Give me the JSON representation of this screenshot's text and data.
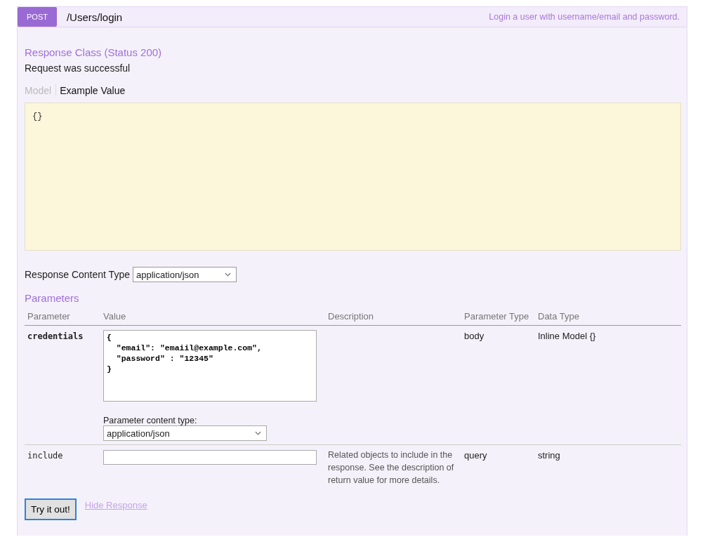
{
  "operation": {
    "method": "POST",
    "path": "/Users/login",
    "summary": "Login a user with username/email and password."
  },
  "response_class": {
    "title": "Response Class (Status 200)",
    "description": "Request was successful",
    "tabs": [
      {
        "label": "Model",
        "selected": false
      },
      {
        "label": "Example Value",
        "selected": true
      }
    ],
    "example_value": "{}"
  },
  "response_content_type": {
    "label": "Response Content Type",
    "value": "application/json"
  },
  "parameters": {
    "title": "Parameters",
    "columns": [
      "Parameter",
      "Value",
      "Description",
      "Parameter Type",
      "Data Type"
    ],
    "rows": [
      {
        "name": "credentials",
        "required": true,
        "kind": "body",
        "value": "{\n  \"email\": \"emaiil@example.com\",\n  \"password\" : \"12345\"\n}",
        "content_type_label": "Parameter content type:",
        "content_type": "application/json",
        "description": "",
        "parameter_type": "body",
        "data_type": "Inline Model {}"
      },
      {
        "name": "include",
        "required": false,
        "kind": "text",
        "value": "",
        "description": "Related objects to include in the response. See the description of return value for more details.",
        "parameter_type": "query",
        "data_type": "string"
      }
    ]
  },
  "actions": {
    "try_button": "Try it out!",
    "hide_link": "Hide Response"
  }
}
